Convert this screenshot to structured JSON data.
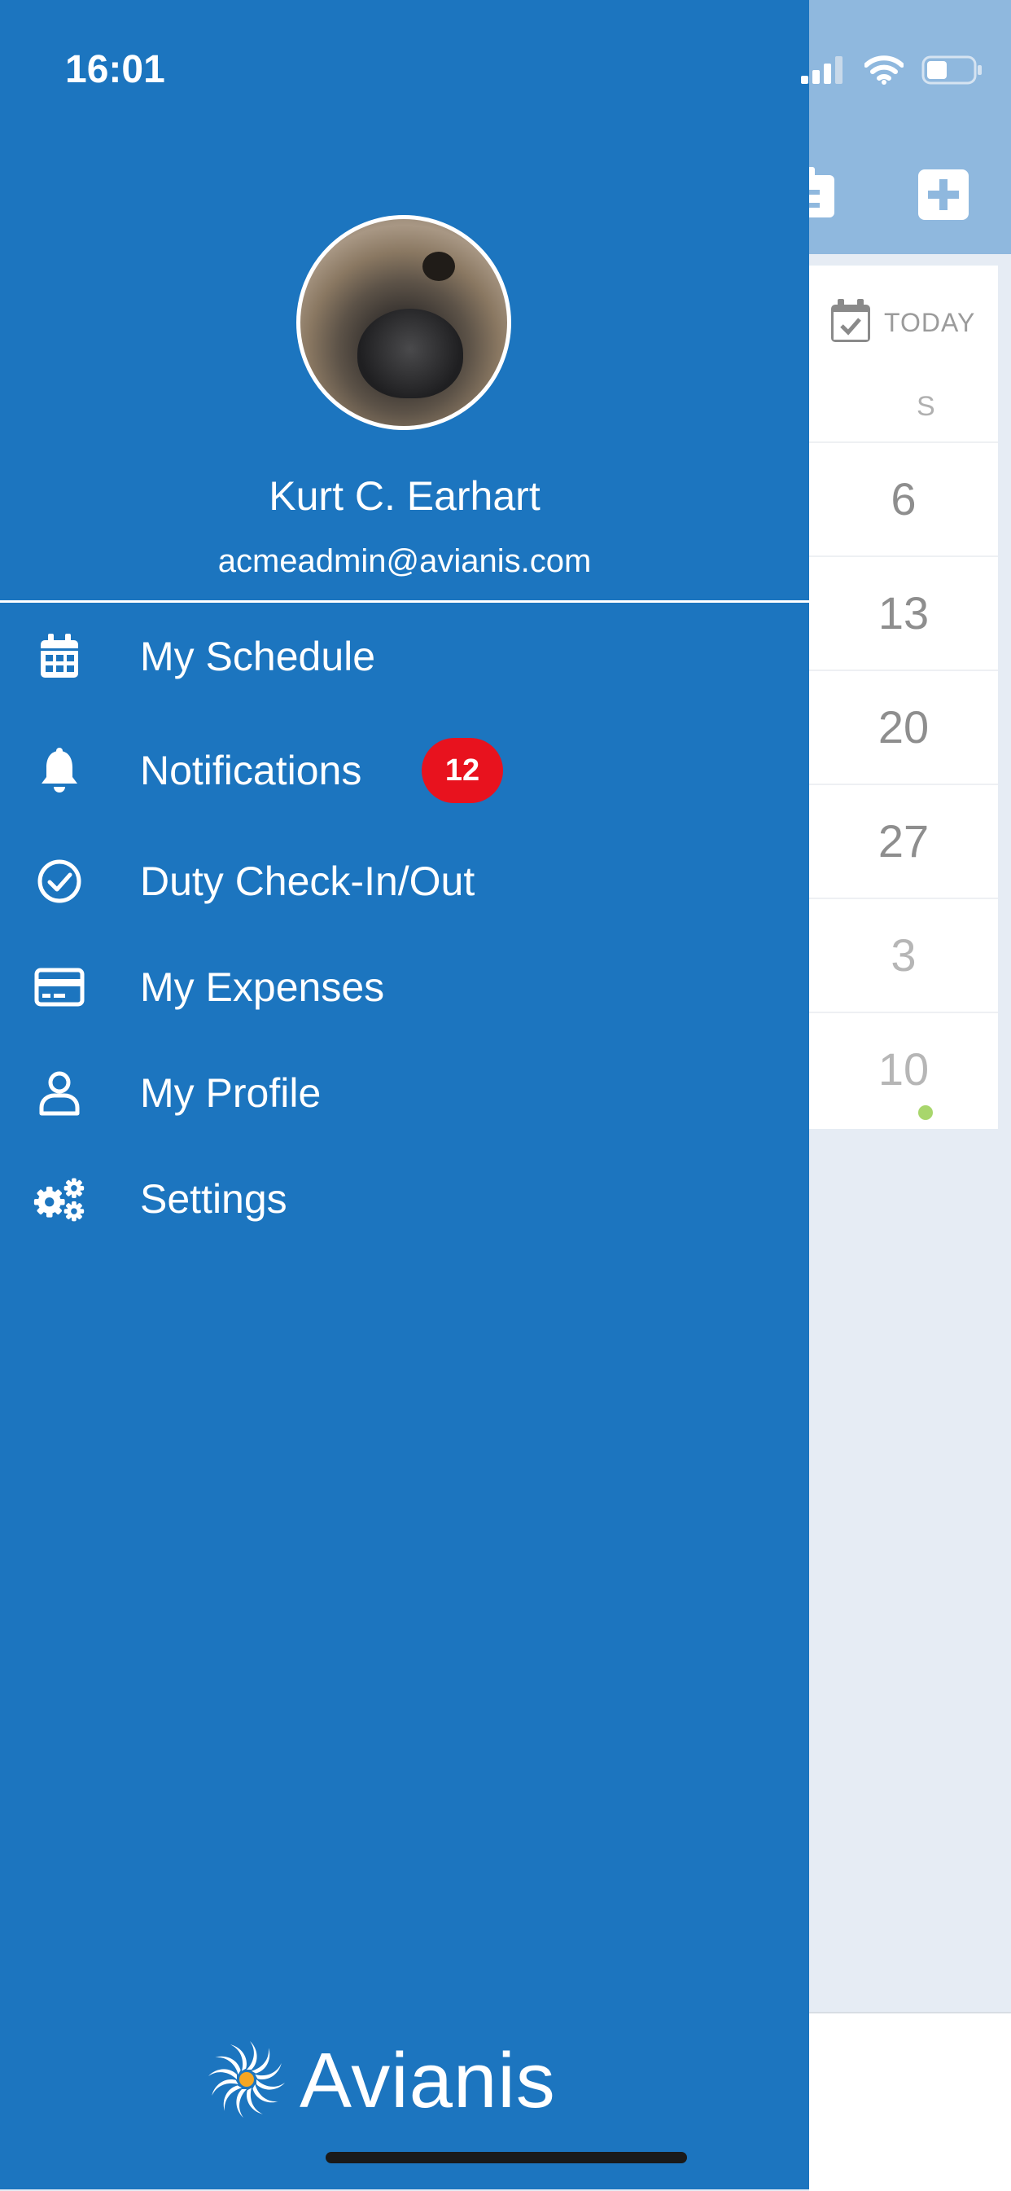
{
  "status_bar": {
    "time": "16:01"
  },
  "profile": {
    "name": "Kurt C. Earhart",
    "email": "acmeadmin@avianis.com"
  },
  "menu": {
    "items": [
      {
        "label": "My Schedule",
        "icon": "calendar-icon"
      },
      {
        "label": "Notifications",
        "icon": "bell-icon",
        "badge": "12"
      },
      {
        "label": "Duty Check-In/Out",
        "icon": "check-circle-icon"
      },
      {
        "label": "My Expenses",
        "icon": "credit-card-icon"
      },
      {
        "label": "My Profile",
        "icon": "user-icon"
      },
      {
        "label": "Settings",
        "icon": "gears-icon"
      }
    ]
  },
  "brand": {
    "name": "Avianis"
  },
  "background": {
    "today_label": "TODAY",
    "weekday_header": "S",
    "days": [
      "6",
      "13",
      "20",
      "27",
      "3",
      "10"
    ]
  },
  "colors": {
    "drawer": "#1c75bf",
    "badge": "#e8121e",
    "header": "#8fb8de"
  }
}
